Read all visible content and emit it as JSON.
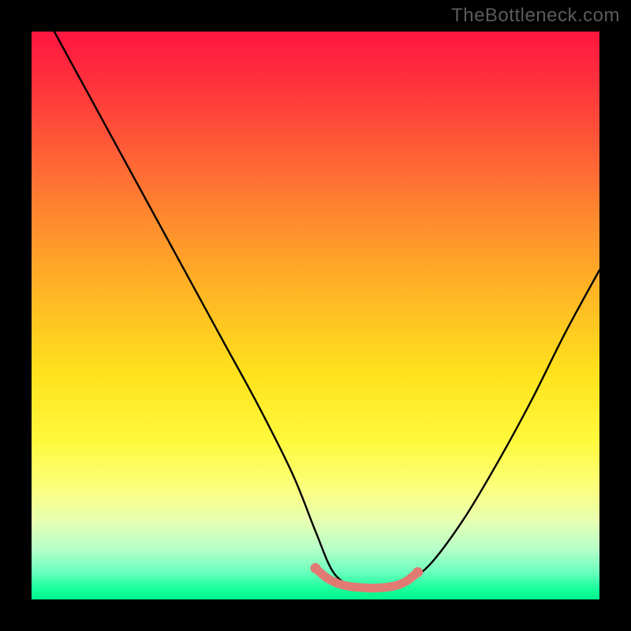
{
  "watermark": "TheBottleneck.com",
  "chart_data": {
    "type": "line",
    "title": "",
    "xlabel": "",
    "ylabel": "",
    "xlim": [
      0,
      100
    ],
    "ylim": [
      0,
      100
    ],
    "grid": false,
    "series": [
      {
        "name": "bottleneck-curve",
        "x": [
          4,
          10,
          16,
          22,
          28,
          34,
          40,
          46,
          50,
          53,
          56,
          59,
          62,
          65,
          70,
          76,
          82,
          88,
          94,
          100
        ],
        "values": [
          100,
          89,
          78,
          67,
          56,
          45,
          34,
          22,
          12,
          5,
          2.5,
          2,
          2,
          2.5,
          6,
          14,
          24,
          35,
          47,
          58
        ]
      }
    ],
    "highlight": {
      "name": "trough-marker",
      "color": "#e27a74",
      "x": [
        50,
        52,
        54,
        56,
        58,
        60,
        62,
        64,
        66,
        68
      ],
      "values": [
        5.5,
        3.8,
        2.8,
        2.3,
        2.1,
        2.0,
        2.1,
        2.4,
        3.2,
        4.8
      ]
    },
    "gradient_colors": {
      "top": "#ff163f",
      "mid_upper": "#ff8a2e",
      "mid": "#ffe11c",
      "mid_lower": "#fcff7a",
      "bottom": "#00f58c"
    }
  }
}
